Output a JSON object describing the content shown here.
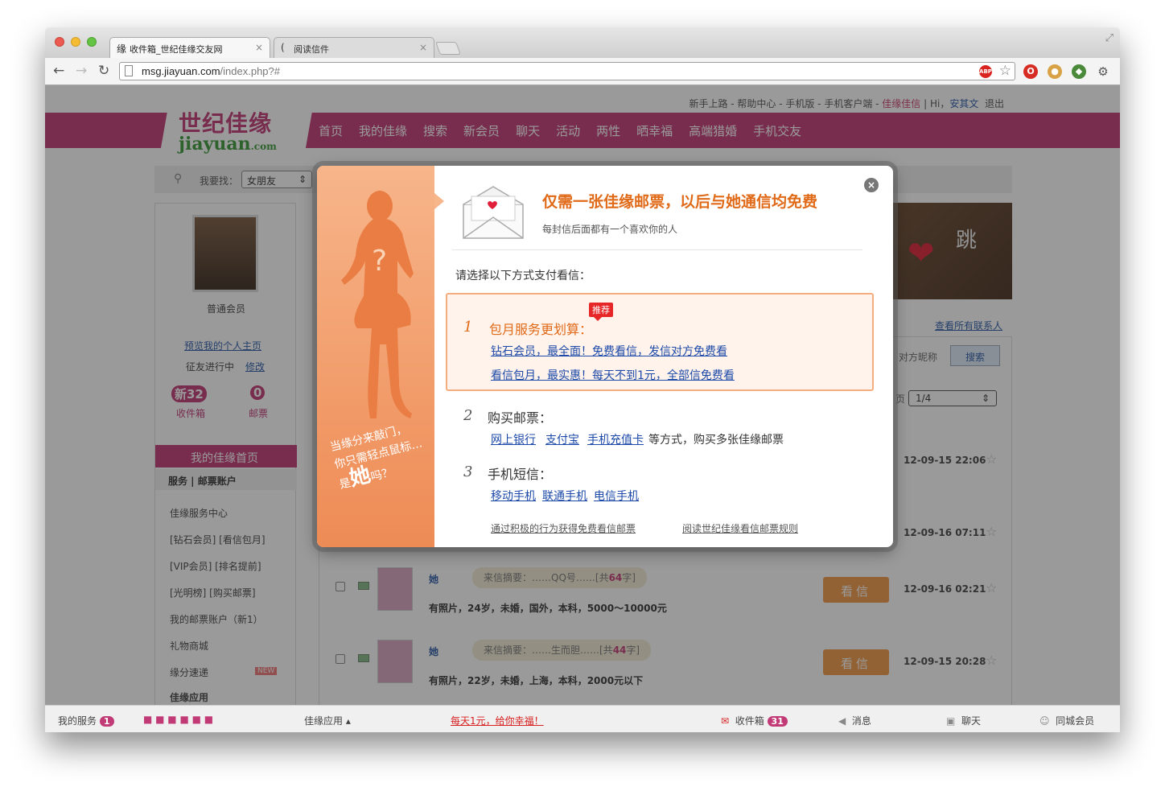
{
  "browser": {
    "tabs": [
      {
        "title": "收件箱_世纪佳缘交友网",
        "active": true
      },
      {
        "title": "阅读信件",
        "active": false
      }
    ],
    "url_host": "msg.jiayuan.com",
    "url_path": "/index.php?#",
    "abp_label": "ABP"
  },
  "site": {
    "top_links": {
      "prefix": "新手上路 - 帮助中心 - 手机版 - 手机客户端 - ",
      "mail": "佳缘佳信",
      "greeting": " | Hi，",
      "user": "安其文",
      "logout": "退出"
    },
    "logo": {
      "cn": "世纪佳缘",
      "en": "jiayuan",
      "suffix": ".com"
    },
    "nav": [
      "首页",
      "我的佳缘",
      "搜索",
      "新会员",
      "聊天",
      "活动",
      "两性",
      "晒幸福",
      "高端猎婚",
      "手机交友"
    ],
    "search": {
      "label": "我要找：",
      "value": "女朋友"
    }
  },
  "sidebar": {
    "member_level": "普通会员",
    "preview_link": "预览我的个人主页",
    "status_label": "征友进行中",
    "edit_link": "修改",
    "inbox_count": "新32",
    "inbox_label": "收件箱",
    "stamp_count": "0",
    "stamp_label": "邮票",
    "home_header": "我的佳缘首页",
    "sub_header": "服务 | 邮票账户",
    "items": [
      "佳缘服务中心",
      "[钻石会员]  [看信包月]",
      "[VIP会员]  [排名提前]",
      "[光明榜]  [购买邮票]",
      "我的邮票账户（新1）",
      "礼物商城",
      "缘分速递",
      "佳缘应用"
    ],
    "new_badge": "NEW"
  },
  "main": {
    "view_all": "查看所有联系人",
    "nickname_placeholder": "对方昵称",
    "search_btn": "搜索",
    "page_select": "1/4",
    "page_label": "页",
    "banner_text": "跳",
    "rows": [
      {
        "date": "12-09-15 22:06"
      },
      {
        "date": "12-09-16 07:11"
      },
      {
        "who": "她",
        "summary_prefix": "来信摘要：……QQ号……[共",
        "summary_count": "64",
        "summary_suffix": "字]",
        "info": "有照片，24岁，未婚，国外，本科，5000～10000元",
        "read_btn": "看信",
        "date": "12-09-16 02:21"
      },
      {
        "who": "她",
        "summary_prefix": "来信摘要：……生而胆……[共",
        "summary_count": "44",
        "summary_suffix": "字]",
        "info": "有照片，22岁，未婚，上海，本科，2000元以下",
        "read_btn": "看信",
        "date": "12-09-15 20:28"
      }
    ]
  },
  "bottom_bar": {
    "services": "我的服务",
    "services_count": "1",
    "apps": "佳缘应用",
    "promo": "每天1元，给你幸福！",
    "inbox": "收件箱",
    "inbox_count": "31",
    "messages": "消息",
    "chat": "聊天",
    "local": "同城会员"
  },
  "modal": {
    "title": "仅需一张佳缘邮票，以后与她通信均免费",
    "subtitle": "每封信后面都有一个喜欢你的人",
    "choose": "请选择以下方式支付看信：",
    "tag": "推荐",
    "opt1_num": "1",
    "opt1_title": "包月服务更划算：",
    "opt1_link1": "钻石会员，最全面！免费看信，发信对方免费看",
    "opt1_link2": "看信包月，最实惠！每天不到1元，全部信免费看",
    "opt2_num": "2",
    "opt2_title": "购买邮票：",
    "opt2_link1": "网上银行",
    "opt2_link2": "支付宝",
    "opt2_link3": "手机充值卡",
    "opt2_suffix": "等方式，购买多张佳缘邮票",
    "opt3_num": "3",
    "opt3_title": "手机短信：",
    "opt3_link1": "移动手机",
    "opt3_link2": "联通手机",
    "opt3_link3": "电信手机",
    "foot_link1": "通过积极的行为获得免费看信邮票",
    "foot_link2": "阅读世纪佳缘看信邮票规则",
    "left_line1": "当缘分来敲门，",
    "left_line2": "你只需轻点鼠标…",
    "left_line3_a": "是",
    "left_line3_b": "她",
    "left_line3_c": "吗？",
    "question_mark": "?"
  }
}
